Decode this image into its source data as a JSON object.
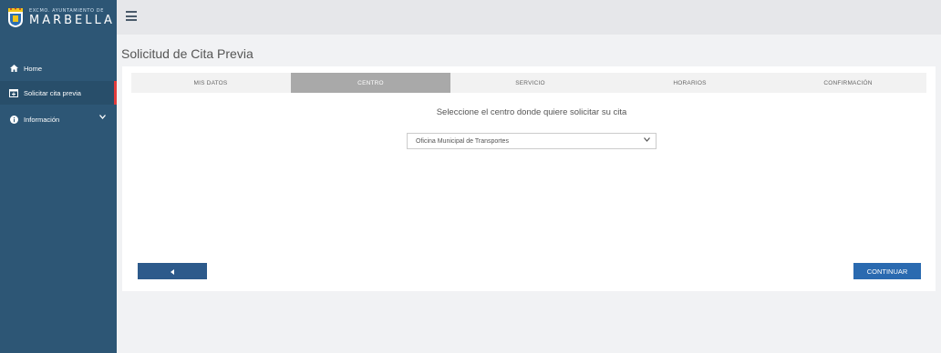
{
  "brand": {
    "small_text": "EXCMO. AYUNTAMIENTO DE",
    "big_text": "MARBELLA"
  },
  "sidebar": {
    "items": [
      {
        "label": "Home",
        "icon": "home-icon"
      },
      {
        "label": "Solicitar cita previa",
        "icon": "calendar-plus-icon",
        "active": true
      },
      {
        "label": "Información",
        "icon": "info-circle-icon",
        "expandable": true
      }
    ]
  },
  "header": {
    "menu_icon": "hamburger-icon",
    "page_title": "Solicitud de Cita Previa"
  },
  "steps": [
    {
      "label": "MIS DATOS",
      "active": false
    },
    {
      "label": "CENTRO",
      "active": true
    },
    {
      "label": "SERVICIO",
      "active": false
    },
    {
      "label": "HORARIOS",
      "active": false
    },
    {
      "label": "CONFIRMACIÓN",
      "active": false
    }
  ],
  "main": {
    "instruction": "Seleccione el centro donde quiere solicitar su cita",
    "center_select_value": "Oficina Municipal de Transportes"
  },
  "buttons": {
    "back_icon": "caret-left-icon",
    "continue_label": "CONTINUAR"
  },
  "colors": {
    "sidebar_bg": "#2d5675",
    "active_marker": "#e23b3b",
    "active_step": "#a9a9a9",
    "primary_button": "#2a6ab0"
  }
}
